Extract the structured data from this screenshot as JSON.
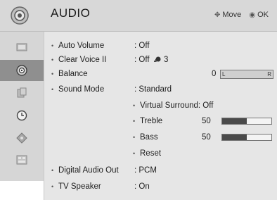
{
  "header": {
    "title": "AUDIO",
    "hint_move_icon": "dpad-icon",
    "hint_move": "Move",
    "hint_ok_icon": "ok-button-icon",
    "hint_ok": "OK"
  },
  "sidebar": {
    "items": [
      {
        "icon": "picture-icon",
        "active": false
      },
      {
        "icon": "audio-speaker-icon",
        "active": true
      },
      {
        "icon": "setup-icon",
        "active": false
      },
      {
        "icon": "clock-icon",
        "active": false
      },
      {
        "icon": "lock-icon",
        "active": false
      },
      {
        "icon": "option-icon",
        "active": false
      }
    ]
  },
  "menu": {
    "auto_volume": {
      "label": "Auto Volume",
      "value": ": Off"
    },
    "clear_voice": {
      "label": "Clear Voice II",
      "value": ": Off",
      "level": "3",
      "level_icon": "voice-level-icon"
    },
    "balance": {
      "label": "Balance",
      "value": "0",
      "left_label": "L",
      "right_label": "R"
    },
    "sound_mode": {
      "label": "Sound Mode",
      "value": ": Standard"
    },
    "virtual_surround": {
      "label": "Virtual Surround",
      "value": ": Off"
    },
    "treble": {
      "label": "Treble",
      "value": "50",
      "level": 0.5
    },
    "bass": {
      "label": "Bass",
      "value": "50",
      "level": 0.5
    },
    "reset": {
      "label": "Reset"
    },
    "digital_audio_out": {
      "label": "Digital Audio Out",
      "value": ": PCM"
    },
    "tv_speaker": {
      "label": "TV Speaker",
      "value": ": On"
    }
  }
}
